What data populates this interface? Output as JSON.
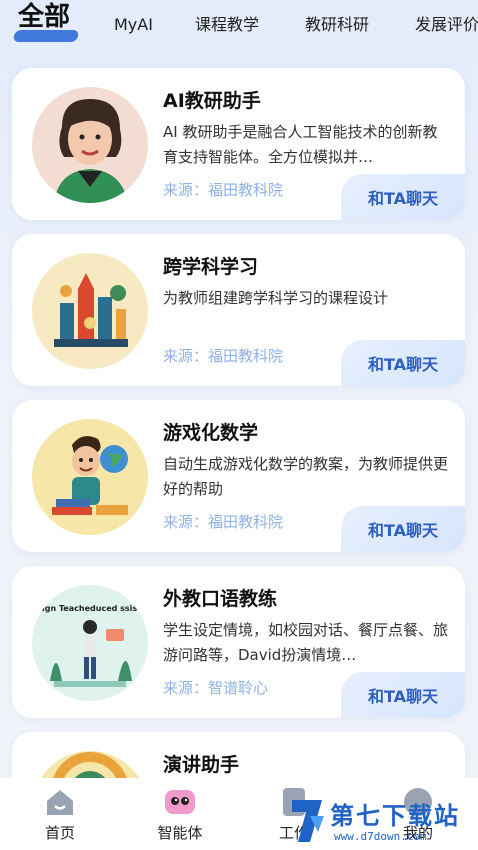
{
  "tabs": {
    "active": "全部",
    "items": [
      "MyAI",
      "课程教学",
      "教研科研",
      "发展评价"
    ]
  },
  "cards": [
    {
      "title": "AI教研助手",
      "desc": "AI 教研助手是融合人工智能技术的创新教育支持智能体。全方位模拟并…",
      "source": "来源：福田教科院",
      "button": "和TA聊天"
    },
    {
      "title": "跨学科学习",
      "desc": "为教师组建跨学科学习的课程设计",
      "source": "来源：福田教科院",
      "button": "和TA聊天"
    },
    {
      "title": "游戏化数学",
      "desc": " 自动生成游戏化数学的教案，为教师提供更好的帮助",
      "source": "来源：福田教科院",
      "button": "和TA聊天"
    },
    {
      "title": "外教口语教练",
      "desc": "学生设定情境，如校园对话、餐厅点餐、旅游问路等，David扮演情境…",
      "source": "来源：智谱聆心",
      "button": "和TA聊天",
      "avatar_text": "ign Teacheduced ssistant"
    },
    {
      "title": "演讲助手"
    }
  ],
  "nav": {
    "items": [
      "首页",
      "智能体",
      "工作",
      "我的"
    ],
    "icons": [
      "home-icon",
      "agent-icon",
      "work-icon",
      "profile-icon"
    ]
  },
  "watermark": {
    "text": "第七下载站",
    "url": "www.d7down.com"
  },
  "colors": {
    "accent": "#2f6bd8",
    "source": "#8fb2e6",
    "button_text": "#2f5fbf"
  }
}
